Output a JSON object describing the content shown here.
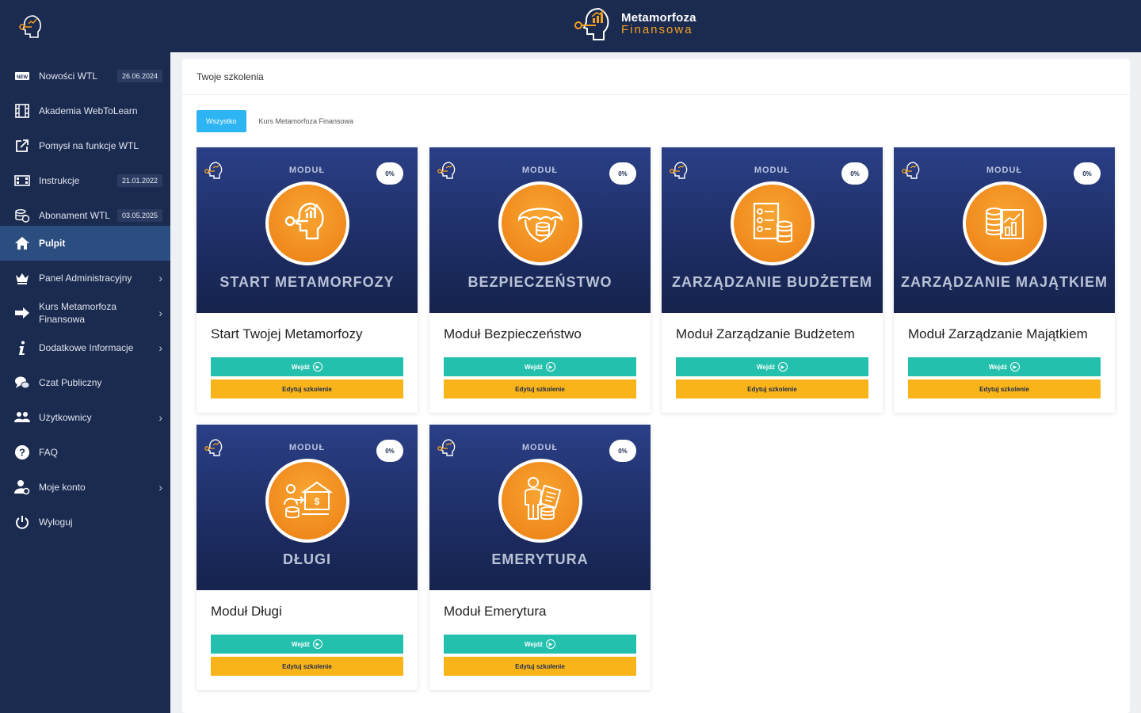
{
  "header": {
    "brand_line1": "Metamorfoza",
    "brand_line2": "Finansowa"
  },
  "sidebar": {
    "items": [
      {
        "label": "Nowości WTL",
        "date": "26.06.2024",
        "icon": "new-badge-icon"
      },
      {
        "label": "Akademia WebToLearn",
        "icon": "film-icon"
      },
      {
        "label": "Pomysł na funkcje WTL",
        "icon": "external-link-icon"
      },
      {
        "label": "Instrukcje",
        "date": "21.01.2022",
        "icon": "video-icon"
      },
      {
        "label": "Abonament WTL",
        "date": "03.05.2025",
        "icon": "coins-icon"
      },
      {
        "label": "Pulpit",
        "icon": "home-icon",
        "active": true
      },
      {
        "label": "Panel Administracyjny",
        "icon": "crown-icon",
        "chevron": "›"
      },
      {
        "label": "Kurs Metamorfoza Finansowa",
        "icon": "arrow-right-icon",
        "chevron": "›"
      },
      {
        "label": "Dodatkowe Informacje",
        "icon": "info-icon",
        "chevron": "›"
      },
      {
        "label": "Czat Publiczny",
        "icon": "chat-icon"
      },
      {
        "label": "Użytkownicy",
        "icon": "users-icon",
        "chevron": "›"
      },
      {
        "label": "FAQ",
        "icon": "question-icon"
      },
      {
        "label": "Moje konto",
        "icon": "user-settings-icon",
        "chevron": "›"
      },
      {
        "label": "Wyloguj",
        "icon": "power-icon"
      }
    ]
  },
  "main": {
    "title": "Twoje szkolenia",
    "filters": [
      {
        "label": "Wszystko",
        "active": true
      },
      {
        "label": "Kurs Metamorfoza Finansowa",
        "active": false
      }
    ],
    "modul_label": "MODUŁ",
    "enter_label": "Wejdź",
    "edit_label": "Edytuj szkolenie",
    "cards": [
      {
        "module_name": "START METAMORFOZY",
        "title": "Start Twojej Metamorfozy",
        "progress": "0%",
        "icon": "head-chart-icon"
      },
      {
        "module_name": "BEZPIECZEŃSTWO",
        "title": "Moduł Bezpieczeństwo",
        "progress": "0%",
        "icon": "umbrella-coins-icon"
      },
      {
        "module_name": "ZARZĄDZANIE BUDŻETEM",
        "title": "Moduł Zarządzanie Budżetem",
        "progress": "0%",
        "icon": "checklist-coins-icon"
      },
      {
        "module_name": "ZARZĄDZANIE MAJĄTKIEM",
        "title": "Moduł Zarządzanie Majątkiem",
        "progress": "0%",
        "icon": "coins-chart-icon"
      },
      {
        "module_name": "DŁUGI",
        "title": "Moduł Długi",
        "progress": "0%",
        "icon": "bank-transfer-icon"
      },
      {
        "module_name": "EMERYTURA",
        "title": "Moduł Emerytura",
        "progress": "0%",
        "icon": "retiree-icon"
      }
    ]
  },
  "colors": {
    "navy": "#1b2a4f",
    "accent_orange": "#f6a21e",
    "enter_button": "#23c0ad",
    "edit_button": "#f9b41a",
    "filter_active": "#2cb5f2"
  }
}
